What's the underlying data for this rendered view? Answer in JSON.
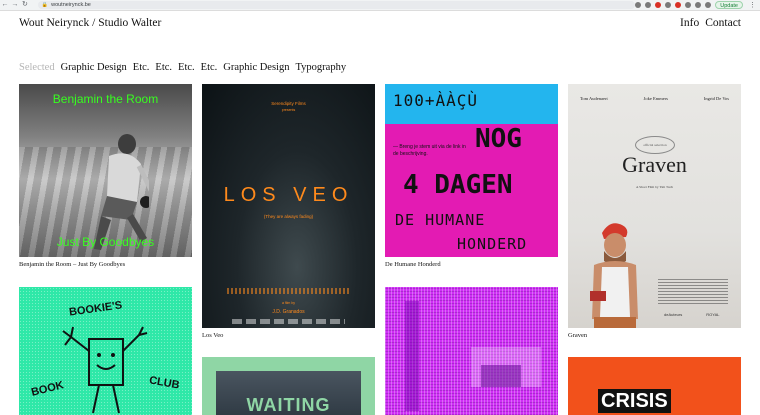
{
  "browser": {
    "url": "woutneirynck.be",
    "update_label": "Update"
  },
  "site": {
    "title": "Wout Neirynck / Studio Walter",
    "nav": [
      "Info",
      "Contact"
    ]
  },
  "filters": [
    "Selected",
    "Graphic Design",
    "Etc.",
    "Etc.",
    "Etc.",
    "Etc.",
    "Graphic Design",
    "Typography"
  ],
  "projects": [
    {
      "caption": "Benjamin the Room – Just By Goodbyes",
      "poster_title": "Benjamin the Room",
      "poster_subtitle": "Just By Goodbyes"
    },
    {
      "caption": "Los Veo",
      "studio": "Serendipity Films",
      "presents": "presents",
      "poster_title": "LOS VEO",
      "tagline": "(They are always fading)",
      "director_label": "a film by",
      "director": "J.D. Granados"
    },
    {
      "caption": "De Humane Honderd",
      "counter": "100+ÀÀÇÙ",
      "big_top": "NOG",
      "big_bottom": "4 DAGEN",
      "message": "— Breng je stem uit via de link in de beschrijving.",
      "lower_1": "DE HUMANE",
      "lower_2": "HONDERD"
    },
    {
      "caption": "Graven",
      "names": [
        "Tom Audenaert",
        "Joke Emmers",
        "Ingrid De Vos"
      ],
      "laurel": "official selection",
      "poster_title": "Graven",
      "tagline": "A Short Film by Tim Tuch",
      "logos": [
        "deAuteurs",
        "ROYAL"
      ]
    },
    {
      "caption": "",
      "words": [
        "BOOKIE'S",
        "BOOK",
        "CLUB"
      ]
    },
    {
      "caption": ""
    },
    {
      "caption": "",
      "poster_title": "WAITING"
    },
    {
      "caption": "",
      "poster_title": "CRISIS"
    }
  ]
}
